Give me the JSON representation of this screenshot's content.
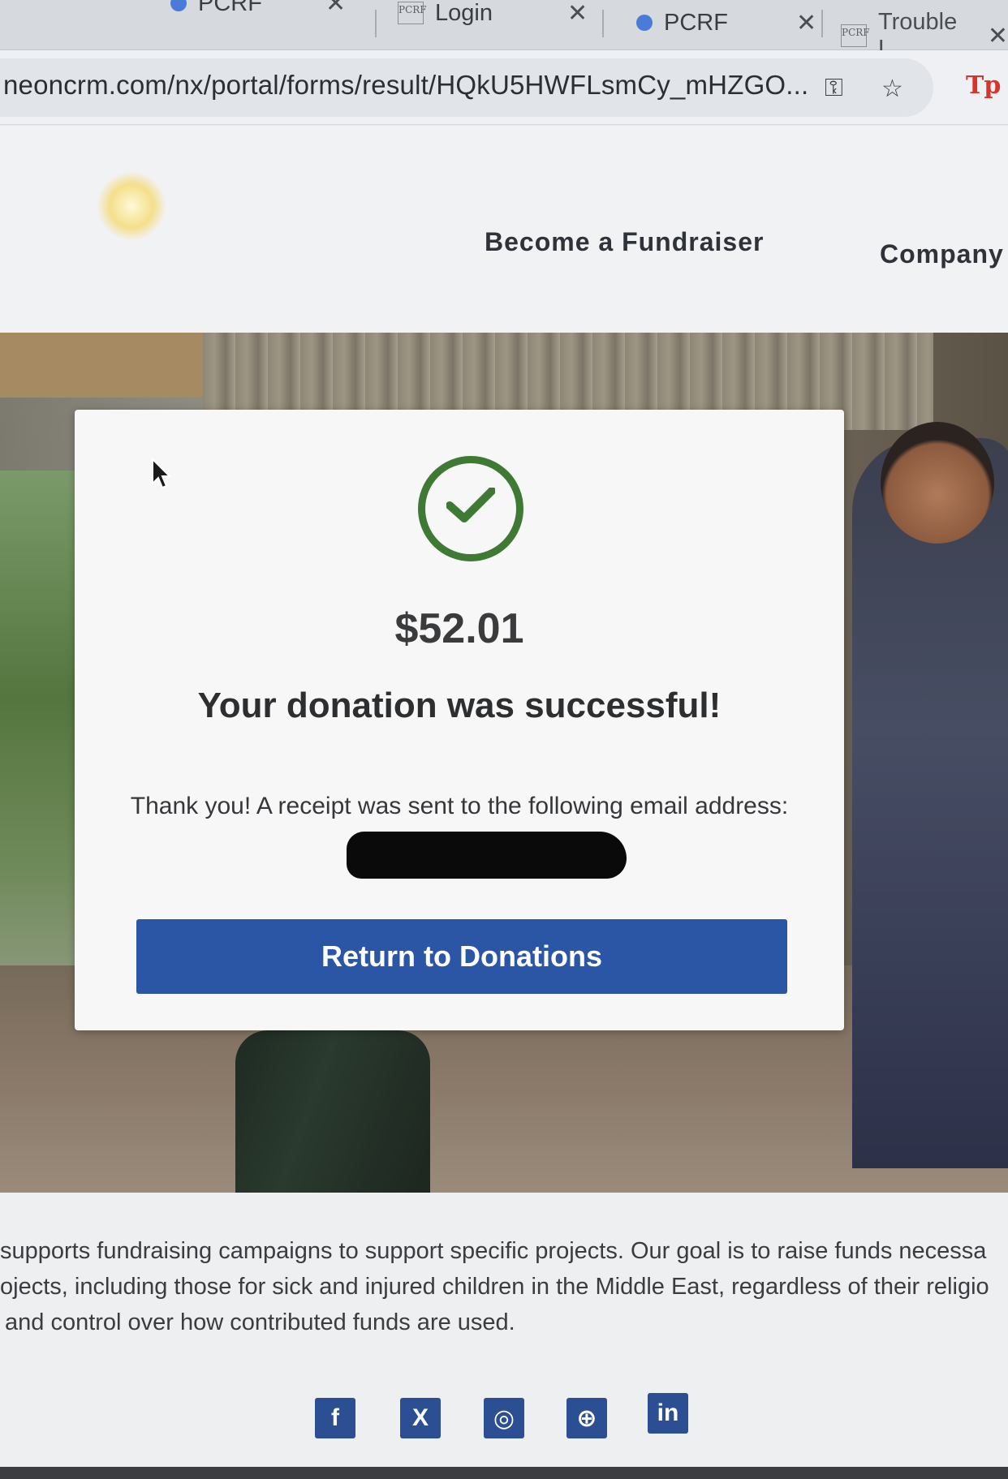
{
  "browser": {
    "tabs": [
      {
        "title": "PCRF",
        "favicon": "dot-icon"
      },
      {
        "title": "Login",
        "favicon": "pcrf-logo-icon"
      },
      {
        "title": "PCRF",
        "favicon": "dot-icon"
      },
      {
        "title": "Trouble L",
        "favicon": "pcrf-logo-icon"
      }
    ],
    "logo_text": "PCRF",
    "url": "neoncrm.com/nx/portal/forms/result/HQkU5HWFLsmCy_mHZGO...",
    "extension_label": "Tp"
  },
  "site_nav": {
    "become_fundraiser": "Become a Fundraiser",
    "company": "Company N"
  },
  "result": {
    "amount": "$52.01",
    "headline": "Your donation was successful!",
    "receipt_text": "Thank you! A receipt was sent to the following email address:",
    "return_button": "Return to Donations"
  },
  "footer": {
    "about_lines": [
      "supports fundraising campaigns to support specific projects. Our goal is to raise funds necessa",
      "ojects, including those for sick and injured children in the Middle East, regardless of their religio",
      "and control over how contributed funds are used."
    ],
    "social": [
      {
        "name": "facebook-icon",
        "glyph": "f"
      },
      {
        "name": "x-icon",
        "glyph": "X"
      },
      {
        "name": "instagram-icon",
        "glyph": "◎"
      },
      {
        "name": "website-icon",
        "glyph": "⊕"
      },
      {
        "name": "linkedin-icon",
        "glyph": "in"
      }
    ]
  },
  "colors": {
    "success_green": "#3f7a34",
    "button_blue": "#2b56a6",
    "social_blue": "#2c4f93"
  }
}
